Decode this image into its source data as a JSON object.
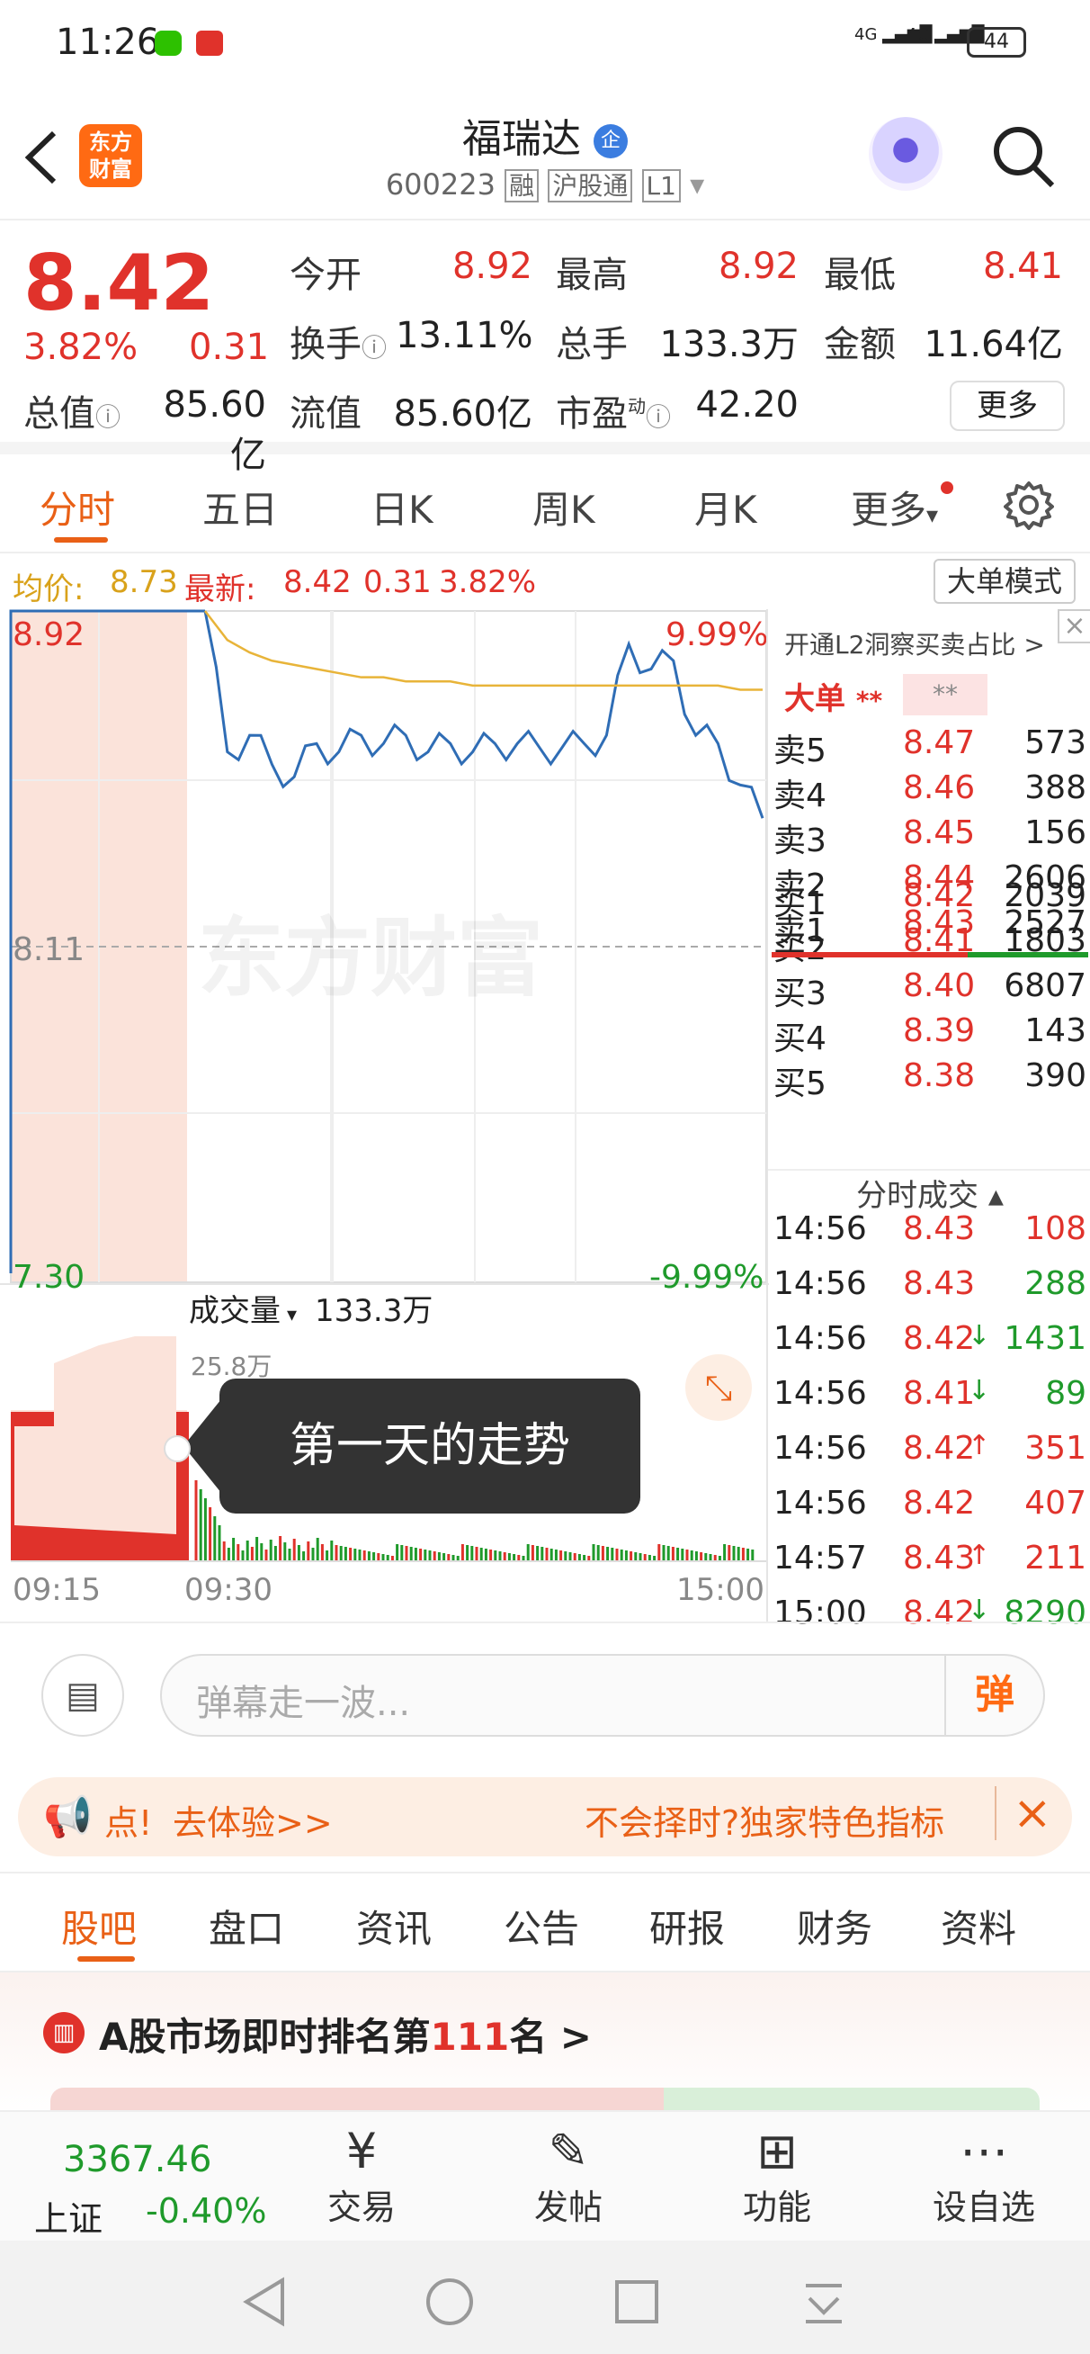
{
  "status": {
    "time": "11:26",
    "battery": "44",
    "signal1": "4G",
    "signal2": "4G"
  },
  "header": {
    "title": "福瑞达",
    "enterprise_badge": "企",
    "code": "600223",
    "tags": [
      "融",
      "沪股通",
      "L1"
    ],
    "logo_text": "东方\n财富"
  },
  "quote": {
    "price": "8.42",
    "pct": "3.82%",
    "chg": "0.31",
    "open_label": "今开",
    "open": "8.92",
    "high_label": "最高",
    "high": "8.92",
    "low_label": "最低",
    "low": "8.41",
    "turnover_label": "换手",
    "turnover": "13.11%",
    "volume_label": "总手",
    "volume": "133.3万",
    "amount_label": "金额",
    "amount": "11.64亿",
    "mktcap_label": "总值",
    "mktcap": "85.60亿",
    "float_label": "流值",
    "float": "85.60亿",
    "pe_label": "市盈",
    "pe_sup": "动",
    "pe": "42.20",
    "more_label": "更多"
  },
  "tabs": [
    "分时",
    "五日",
    "日K",
    "周K",
    "月K",
    "更多"
  ],
  "chart_info": {
    "avg_label": "均价:",
    "avg": "8.73",
    "latest_label": "最新:",
    "latest": "8.42",
    "chg": "0.31",
    "pct": "3.82%",
    "mode_button": "大单模式"
  },
  "chart": {
    "high_price": "8.92",
    "high_pct": "9.99%",
    "mid_price": "8.11",
    "low_price": "7.30",
    "low_pct": "-9.99%",
    "watermark": "东方财富",
    "vol_label": "成交量",
    "vol_total": "133.3万",
    "vol_max": "25.8万",
    "t_start": "09:15",
    "t_open": "09:30",
    "t_end": "15:00",
    "tooltip": "第一天的走势"
  },
  "chart_data": {
    "type": "line",
    "title": "",
    "ylim": [
      7.3,
      8.92
    ],
    "x": [
      "09:30",
      "09:35",
      "09:40",
      "09:45",
      "09:50",
      "09:55",
      "10:00",
      "10:10",
      "10:20",
      "10:30",
      "10:45",
      "11:00",
      "11:15",
      "11:30",
      "13:00",
      "13:15",
      "13:30",
      "13:45",
      "14:00",
      "14:10",
      "14:20",
      "14:30",
      "14:40",
      "14:50",
      "14:56",
      "15:00"
    ],
    "series": [
      {
        "name": "最新",
        "values": [
          8.92,
          8.58,
          8.62,
          8.55,
          8.52,
          8.6,
          8.58,
          8.62,
          8.6,
          8.62,
          8.58,
          8.6,
          8.58,
          8.6,
          8.6,
          8.59,
          8.59,
          8.6,
          8.62,
          8.84,
          8.78,
          8.8,
          8.62,
          8.6,
          8.5,
          8.42
        ]
      },
      {
        "name": "均价",
        "values": [
          8.92,
          8.85,
          8.82,
          8.8,
          8.79,
          8.78,
          8.77,
          8.76,
          8.76,
          8.75,
          8.75,
          8.75,
          8.74,
          8.74,
          8.74,
          8.74,
          8.74,
          8.74,
          8.74,
          8.74,
          8.74,
          8.74,
          8.74,
          8.74,
          8.73,
          8.73
        ]
      }
    ]
  },
  "book": {
    "l2_label": "开通L2洞察买卖占比 >",
    "big_label": "大单",
    "stars1": "**",
    "stars2": "**",
    "asks": [
      {
        "label": "卖5",
        "price": "8.47",
        "vol": "573"
      },
      {
        "label": "卖4",
        "price": "8.46",
        "vol": "388"
      },
      {
        "label": "卖3",
        "price": "8.45",
        "vol": "156"
      },
      {
        "label": "卖2",
        "price": "8.44",
        "vol": "2606"
      },
      {
        "label": "卖1",
        "price": "8.43",
        "vol": "2527"
      }
    ],
    "bids": [
      {
        "label": "买1",
        "price": "8.42",
        "vol": "2039"
      },
      {
        "label": "买2",
        "price": "8.41",
        "vol": "1803"
      },
      {
        "label": "买3",
        "price": "8.40",
        "vol": "6807"
      },
      {
        "label": "买4",
        "price": "8.39",
        "vol": "143"
      },
      {
        "label": "买5",
        "price": "8.38",
        "vol": "390"
      }
    ],
    "trades_label": "分时成交",
    "trades": [
      {
        "time": "14:56",
        "price": "8.43",
        "dir": "",
        "vol": "108",
        "color": "red"
      },
      {
        "time": "14:56",
        "price": "8.43",
        "dir": "",
        "vol": "288",
        "color": "green"
      },
      {
        "time": "14:56",
        "price": "8.42",
        "dir": "↓",
        "vol": "1431",
        "color": "green"
      },
      {
        "time": "14:56",
        "price": "8.41",
        "dir": "↓",
        "vol": "89",
        "color": "green"
      },
      {
        "time": "14:56",
        "price": "8.42",
        "dir": "↑",
        "vol": "351",
        "color": "red"
      },
      {
        "time": "14:56",
        "price": "8.42",
        "dir": "",
        "vol": "407",
        "color": "red"
      },
      {
        "time": "14:57",
        "price": "8.43",
        "dir": "↑",
        "vol": "211",
        "color": "red"
      },
      {
        "time": "15:00",
        "price": "8.42",
        "dir": "↓",
        "vol": "8290",
        "color": "green"
      }
    ]
  },
  "danmu": {
    "placeholder": "弹幕走一波...",
    "send_label": "弹"
  },
  "banner": {
    "left": "点!",
    "link": "去体验>>",
    "right": "不会择时?独家特色指标"
  },
  "bottom_tabs": [
    "股吧",
    "盘口",
    "资讯",
    "公告",
    "研报",
    "财务",
    "资料"
  ],
  "rank": {
    "text_pre": "A股市场即时排名第",
    "rank": "111",
    "text_post": "名 >"
  },
  "bottombar": {
    "index_value": "3367.46",
    "index_name": "上证",
    "index_pct": "-0.40%",
    "items": [
      "交易",
      "发帖",
      "功能",
      "设自选"
    ]
  },
  "colors": {
    "red": "#e0322b",
    "green": "#1f9a2b",
    "orange": "#ff6a13"
  }
}
